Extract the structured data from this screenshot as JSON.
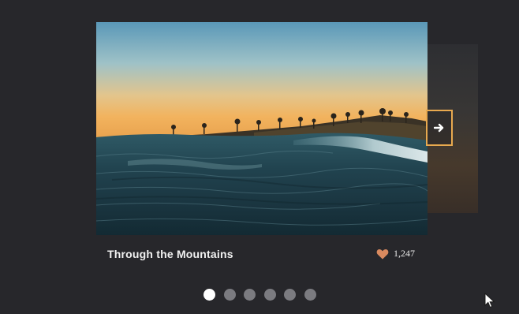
{
  "carousel": {
    "slide": {
      "title": "Through the Mountains",
      "likes": "1,247",
      "image": "ocean wave at sunset with palm trees on shore"
    },
    "next_icon": "arrow-right-icon",
    "like_icon": "heart-icon",
    "pagination": {
      "total": 6,
      "active_index": 0
    }
  },
  "colors": {
    "background": "#27272b",
    "accent": "#e8a94f",
    "heart": "#d98a5f",
    "dot_active": "#ffffff",
    "dot_inactive": "#7b7b80"
  }
}
